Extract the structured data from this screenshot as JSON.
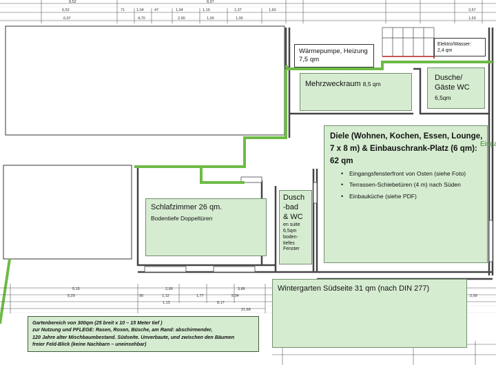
{
  "rooms": {
    "waermepumpe": {
      "line1": "Wärmepumpe, Heizung",
      "line2": "7,5 qm"
    },
    "elektro": {
      "line1": "Elektro/Wasser:",
      "line2": "2,4 qm"
    },
    "mehrzweck": {
      "name": "Mehrzweckraum",
      "area": "8,5 qm"
    },
    "dusche_gaeste": {
      "line1": "Dusche/",
      "line2": "Gäste WC",
      "area": "6,5qm"
    },
    "diele": {
      "title_line1": "Diele (Wohnen, Kochen, Essen, Lounge,",
      "title_line2": "7 x 8 m) & Einbauschrank-Platz (6 qm):",
      "title_line3": "62 qm",
      "bullets": [
        "Eingangsfensterfront von Osten (siehe Foto)",
        "Terrassen-Schiebetüren (4 m) nach Süden",
        "Einbauküche (siehe PDF)"
      ]
    },
    "eingang_partial": "Einga",
    "schlafzimmer": {
      "name": "Schlafzimmer 26 qm.",
      "sub": "Bodentiefe Doppeltüren"
    },
    "duschbad": {
      "line1": "Dusch",
      "line2": "-bad",
      "line3": "& WC",
      "sub1": "en suite",
      "sub2": "6,5qm",
      "sub3": "boden-",
      "sub4": "tiefes",
      "sub5": "Fenster"
    },
    "wintergarten": {
      "name": "Wintergarten Südseite 31 qm (nach DIN 277)"
    }
  },
  "garden_note": {
    "line1": "Gartenbereich von 300qm (25 breit  x 10 – 15  Meter tief )",
    "line2": "zur Nutzung und PFLEGE: Rasen, Rosen, Büsche,  am Rand: abschirmender,",
    "line3": "120 Jahre alter Mischbaumbestand. Südseite. Unverbaute, und zwischen den Bäumen",
    "line4": "freier Feld-Blick (keine Nachbarn – uneinsehbar)"
  },
  "dimensions": {
    "top": [
      "8,52",
      "8,97",
      "6,52",
      "71",
      "1,04",
      "47",
      "1,04",
      "1,19",
      "1,37",
      "1,60",
      "6,07",
      "4,70",
      "2,90",
      "1,00",
      "1,00",
      "3,57",
      "1,53"
    ],
    "bottom": [
      "5,15",
      "2,99",
      "3,86",
      "5,29",
      "90",
      "1,12",
      "1,77",
      "5,34",
      "2,09",
      "8,17",
      "1,13",
      "21,68"
    ]
  },
  "colors": {
    "room_fill": "#d6ecd1",
    "boundary_green": "#6dbb45",
    "wall": "#444444"
  }
}
